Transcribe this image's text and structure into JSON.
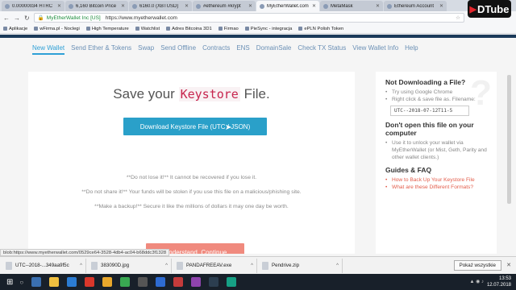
{
  "browser": {
    "tabs": [
      {
        "label": "0.00000034 HTRC",
        "active": false
      },
      {
        "label": "6,160 Bitcoin Price",
        "active": false
      },
      {
        "label": "6160.0 (XBTUSD)",
        "active": false
      },
      {
        "label": "#ethereum #krypt",
        "active": false
      },
      {
        "label": "MyEtherWallet.com",
        "active": true
      },
      {
        "label": "MetaMask",
        "active": false
      },
      {
        "label": "Ethereum Account",
        "active": false
      }
    ],
    "address": {
      "secure_label": "MyEtherWallet Inc [US]",
      "url": "https://www.myetherwallet.com"
    },
    "bookmarks": [
      "Aplikacje",
      "wFirma.pl - Noclegi",
      "High Temperature",
      "Watchlist",
      "Adres Bitcoina 3D1",
      "Firmao",
      "PieSync - integracja",
      "ePLN Polish Token"
    ]
  },
  "nav": {
    "links": [
      "New Wallet",
      "Send Ether & Tokens",
      "Swap",
      "Send Offline",
      "Contracts",
      "ENS",
      "DomainSale",
      "Check TX Status",
      "View Wallet Info",
      "Help"
    ],
    "active_index": 0
  },
  "main": {
    "title_pre": "Save your",
    "title_code": "Keystore",
    "title_post": "File.",
    "download_button": "Download Keystore File (UTC / JSON)",
    "warnings": [
      "**Do not lose it!** It cannot be recovered if you lose it.",
      "**Do not share it!** Your funds will be stolen if you use this file on a malicious/phishing site.",
      "**Make a backup!** Secure it like the millions of dollars it may one day be worth."
    ],
    "continue_button": "I understand. Continue."
  },
  "sidebar": {
    "h1": "Not Downloading a File?",
    "items1": [
      "Try using Google Chrome",
      "Right click & save file as. Filename:"
    ],
    "filename": "UTC--2018-07-12T11-5",
    "h2": "Don't open this file on your computer",
    "items2": [
      "Use it to unlock your wallet via MyEtherWallet (or Mist, Geth, Parity and other wallet clients.)"
    ],
    "h3": "Guides & FAQ",
    "links": [
      "How to Back Up Your Keystore File",
      "What are these Different Formats?"
    ]
  },
  "status_url": "blob:https://www.myetherwallet.com/0529ce64-3528-4db4-ac04-b68ddc3f1328",
  "downloads": {
    "items": [
      "UTC--2018-...349aa9f5c",
      "383090D.jpg",
      "PANDAFREEAV.exe",
      "Pendrive.zip"
    ],
    "show_all": "Pokaż wszystkie"
  },
  "taskbar": {
    "time": "13:53",
    "date": "12.07.2018"
  },
  "watermark": "DTube",
  "colors": {
    "accent": "#2aa0c9",
    "danger_button": "#f08a7e",
    "link_red": "#e35c4a"
  }
}
